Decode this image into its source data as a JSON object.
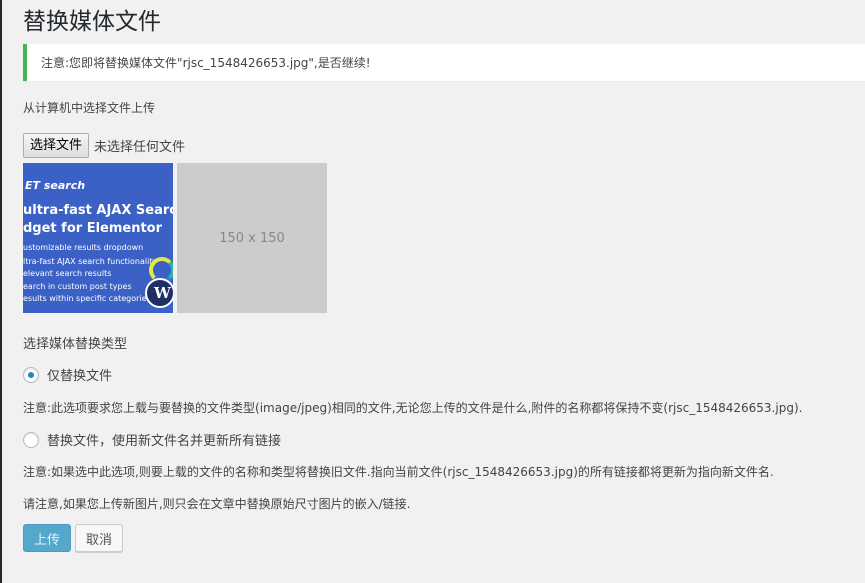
{
  "page": {
    "title": "替换媒体文件"
  },
  "notice": {
    "text": "注意:您即将替换媒体文件\"rjsc_1548426653.jpg\",是否继续!",
    "color": "#46b450"
  },
  "upload": {
    "label": "从计算机中选择文件上传",
    "choose_button": "选择文件",
    "status": "未选择任何文件"
  },
  "thumbnails": {
    "current": {
      "brand": "ET search",
      "headline_1": "ultra-fast AJAX Search",
      "headline_2": "dget for Elementor",
      "features": [
        "ustomizable results dropdown",
        "ltra-fast AJAX search functionality",
        "elevant search results",
        "earch in custom post types",
        "esults within specific categories"
      ]
    },
    "placeholder": {
      "label": "150 x 150"
    }
  },
  "replace_type": {
    "label": "选择媒体替换类型",
    "options": [
      {
        "label": "仅替换文件",
        "checked": true
      },
      {
        "label": "替换文件，使用新文件名并更新所有链接",
        "checked": false
      }
    ]
  },
  "notes": {
    "replace_only": "注意:此选项要求您上载与要替换的文件类型(image/jpeg)相同的文件,无论您上传的文件是什么,附件的名称都将保持不变(rjsc_1548426653.jpg).",
    "replace_rename": "注意:如果选中此选项,则要上载的文件的名称和类型将替换旧文件.指向当前文件(rjsc_1548426653.jpg)的所有链接都将更新为指向新文件名.",
    "image_note": "请注意,如果您上传新图片,则只会在文章中替换原始尺寸图片的嵌入/链接."
  },
  "actions": {
    "upload": "上传",
    "cancel": "取消"
  },
  "colors": {
    "primary": "#54a8cc",
    "radio_checked": "#1e8cbe"
  }
}
